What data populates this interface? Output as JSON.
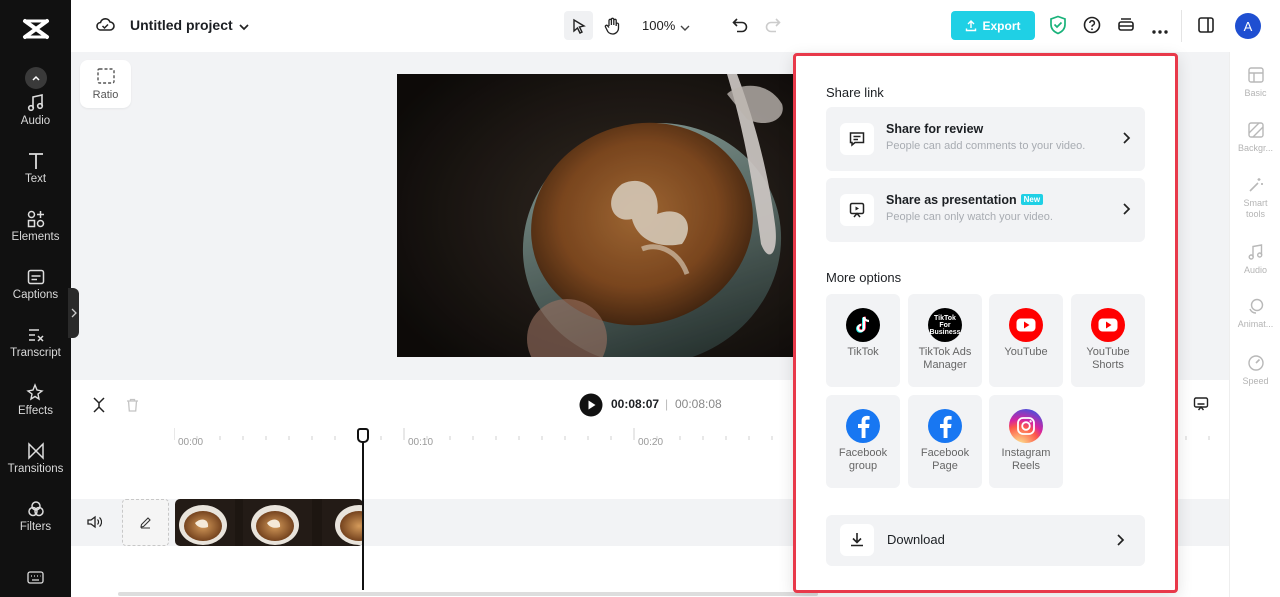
{
  "topbar": {
    "project_title": "Untitled project",
    "zoom": "100%",
    "export_label": "Export",
    "avatar_letter": "A"
  },
  "sidebar": {
    "items": [
      {
        "label": "Audio",
        "icon": "music-note-icon"
      },
      {
        "label": "Text",
        "icon": "text-icon"
      },
      {
        "label": "Elements",
        "icon": "elements-icon"
      },
      {
        "label": "Captions",
        "icon": "captions-icon"
      },
      {
        "label": "Transcript",
        "icon": "transcript-icon"
      },
      {
        "label": "Effects",
        "icon": "effects-icon"
      },
      {
        "label": "Transitions",
        "icon": "transitions-icon"
      },
      {
        "label": "Filters",
        "icon": "filters-icon"
      }
    ]
  },
  "canvas": {
    "ratio_label": "Ratio"
  },
  "rightbar": {
    "items": [
      {
        "label": "Basic"
      },
      {
        "label": "Backgr..."
      },
      {
        "label": "Smart tools"
      },
      {
        "label": "Audio"
      },
      {
        "label": "Animat..."
      },
      {
        "label": "Speed"
      }
    ]
  },
  "timeline": {
    "current_time": "00:08:07",
    "separator": "|",
    "total_time": "00:08:08",
    "ticks": [
      "00:00",
      "00:10",
      "00:20"
    ]
  },
  "share": {
    "share_link_title": "Share link",
    "review": {
      "title": "Share for review",
      "desc": "People can add comments to your video."
    },
    "presentation": {
      "title": "Share as presentation",
      "badge": "New",
      "desc": "People can only watch your video."
    },
    "more_options_title": "More options",
    "options": [
      {
        "label": "TikTok"
      },
      {
        "label": "TikTok Ads Manager"
      },
      {
        "label": "YouTube"
      },
      {
        "label": "YouTube Shorts"
      },
      {
        "label": "Facebook group"
      },
      {
        "label": "Facebook Page"
      },
      {
        "label": "Instagram Reels"
      }
    ],
    "download_label": "Download",
    "tiktok_business_logo_text": "TikTok For Business"
  },
  "colors": {
    "accent": "#1fd0e5",
    "highlight_border": "#e8394a",
    "youtube_red": "#ff0000",
    "facebook_blue": "#1877f2"
  }
}
